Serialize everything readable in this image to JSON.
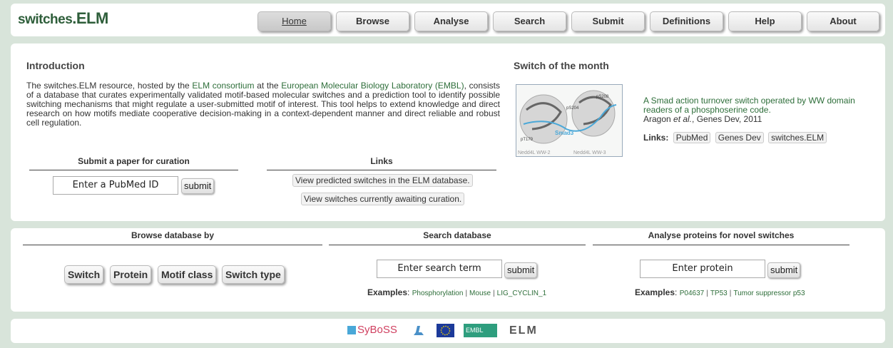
{
  "logo": {
    "part1": "switches",
    "part2": ".ELM"
  },
  "nav": [
    "Home",
    "Browse",
    "Analyse",
    "Search",
    "Submit",
    "Definitions",
    "Help",
    "About"
  ],
  "intro": {
    "title": "Introduction",
    "text_1": "The switches.ELM resource, hosted by the ",
    "link_elm": "ELM consortium",
    "text_2": " at the ",
    "link_embl": "European Molecular Biology Laboratory (EMBL)",
    "text_3": ", consists of a database that curates experimentally validated motif-based molecular switches and a prediction tool to identify possible switching mechanisms that might regulate a user-submitted motif of interest. This tool helps to extend knowledge and direct research on how motifs mediate cooperative decision-making in a context-dependent manner and direct reliable and robust cell regulation."
  },
  "submit_paper": {
    "title": "Submit a paper for curation",
    "placeholder": "Enter a PubMed ID",
    "button": "submit"
  },
  "links": {
    "title": "Links",
    "predicted": "View predicted switches in the ELM database.",
    "awaiting": "View switches currently awaiting curation."
  },
  "switch_of_month": {
    "title": "Switch of the month",
    "image_labels": {
      "pt179": "pT179",
      "ps204": "pS204",
      "ps208": "pS208",
      "smad3": "Smad3",
      "ww2": "Nedd4L WW-2",
      "ww3": "Nedd4L WW-3"
    },
    "article_title": "A Smad action turnover switch operated by WW domain readers of a phosphoserine code.",
    "author": "Aragon ",
    "etal": "et al.",
    "journal": ", Genes Dev, 2011",
    "links_label": "Links:",
    "links": [
      "PubMed",
      "Genes Dev",
      "switches.ELM"
    ]
  },
  "browse": {
    "title": "Browse database by",
    "buttons": [
      "Switch",
      "Protein",
      "Motif class",
      "Switch type"
    ]
  },
  "search": {
    "title": "Search database",
    "placeholder": "Enter search term",
    "button": "submit",
    "examples_label": "Examples",
    "examples": [
      "Phosphorylation",
      "Mouse",
      "LIG_CYCLIN_1"
    ]
  },
  "analyse": {
    "title": "Analyse proteins for novel switches",
    "placeholder": "Enter protein",
    "button": "submit",
    "examples_label": "Examples",
    "examples": [
      "P04637",
      "TP53",
      "Tumor suppressor p53"
    ]
  },
  "footer": {
    "syboss": "SyBoSS",
    "embl": "EMBL",
    "elm": "ELM"
  },
  "colors": {
    "background": "#d8e4da",
    "link": "#2e6e3a",
    "logo": "#2e5e3a",
    "smad3": "#4aa8d8"
  }
}
